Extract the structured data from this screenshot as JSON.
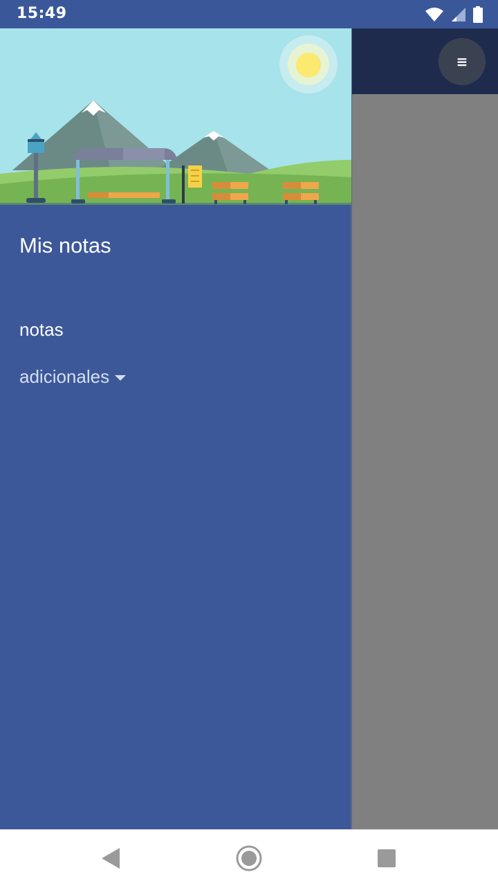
{
  "status_bar": {
    "time": "15:49",
    "icons": [
      "wifi-icon",
      "signal-icon",
      "battery-icon"
    ]
  },
  "drawer": {
    "title": "Mis notas",
    "header_image": "park-bus-stop-illustration",
    "items": [
      {
        "label": "notas"
      },
      {
        "label": "adicionales",
        "icon": "dropdown-caret-icon"
      }
    ]
  },
  "toolbar": {
    "menu_icon_glyph": "≡",
    "menu_icon": "hamburger-menu-icon"
  },
  "navigation_bar": {
    "buttons": [
      "back-icon",
      "home-icon",
      "recents-icon"
    ]
  },
  "colors": {
    "status_bar": "#3a5899",
    "drawer_bg": "#3c5899",
    "toolbar_bg": "#1f2b4d",
    "scrim": "#808080"
  }
}
